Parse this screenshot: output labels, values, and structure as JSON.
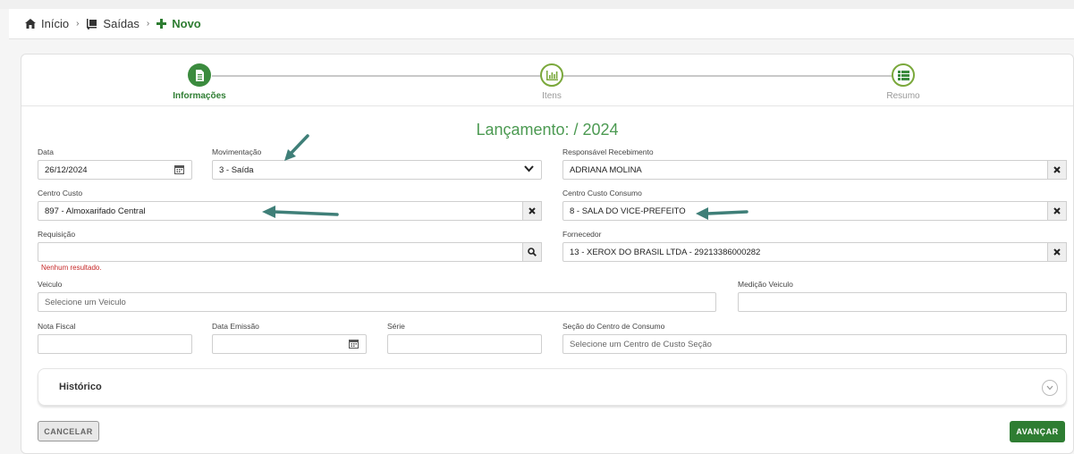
{
  "breadcrumb": {
    "home": "Início",
    "outputs": "Saídas",
    "current": "Novo"
  },
  "stepper": {
    "steps": [
      {
        "label": "Informações",
        "icon": "document-icon",
        "state": "active"
      },
      {
        "label": "Itens",
        "icon": "chart-icon",
        "state": "inactive"
      },
      {
        "label": "Resumo",
        "icon": "list-icon",
        "state": "inactive"
      }
    ]
  },
  "form": {
    "title": "Lançamento: / 2024",
    "data": {
      "label": "Data",
      "value": "26/12/2024"
    },
    "movimentacao": {
      "label": "Movimentação",
      "value": "3 - Saída"
    },
    "responsavel": {
      "label": "Responsável Recebimento",
      "value": "ADRIANA MOLINA"
    },
    "centro_custo": {
      "label": "Centro Custo",
      "value": "897 - Almoxarifado Central"
    },
    "centro_custo_consumo": {
      "label": "Centro Custo Consumo",
      "value": "8 - SALA DO VICE-PREFEITO"
    },
    "requisicao": {
      "label": "Requisição",
      "value": "",
      "error": "Nenhum resultado."
    },
    "fornecedor": {
      "label": "Fornecedor",
      "value": "13 - XEROX DO BRASIL LTDA - 29213386000282"
    },
    "veiculo": {
      "label": "Veiculo",
      "placeholder": "Selecione um Veiculo"
    },
    "medicao_veiculo": {
      "label": "Medição Veiculo",
      "value": ""
    },
    "nota_fiscal": {
      "label": "Nota Fiscal",
      "value": ""
    },
    "data_emissao": {
      "label": "Data Emissão",
      "value": ""
    },
    "serie": {
      "label": "Série",
      "value": ""
    },
    "secao_centro": {
      "label": "Seção do Centro de Consumo",
      "placeholder": "Selecione um Centro de Custo Seção"
    }
  },
  "historico": {
    "label": "Histórico"
  },
  "actions": {
    "cancel": "CANCELAR",
    "advance": "AVANÇAR"
  },
  "colors": {
    "primary_green": "#2e7d32",
    "title_green": "#4c9a52",
    "annotation_arrow": "#3f7f78",
    "error_red": "#c62828"
  }
}
